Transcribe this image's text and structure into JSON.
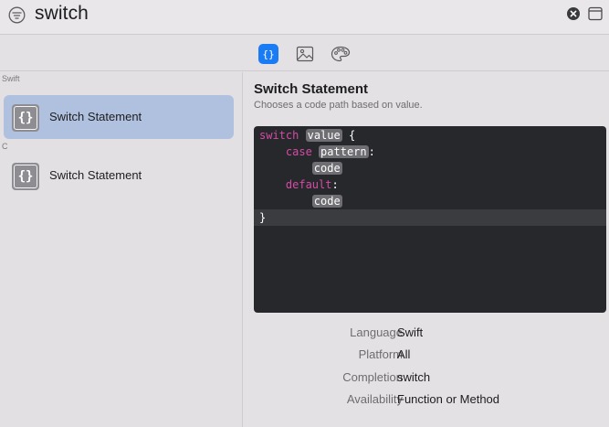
{
  "search": {
    "query": "switch"
  },
  "toolbar": {
    "tabs": [
      {
        "name": "code-snippets",
        "selected": true
      },
      {
        "name": "media",
        "selected": false
      },
      {
        "name": "colors",
        "selected": false
      }
    ]
  },
  "sidebar": {
    "sections": [
      {
        "header": "Swift",
        "items": [
          {
            "label": "Switch Statement",
            "icon": "{}",
            "selected": true
          }
        ]
      },
      {
        "header": "C",
        "items": [
          {
            "label": "Switch Statement",
            "icon": "{}",
            "selected": false
          }
        ]
      }
    ]
  },
  "detail": {
    "title": "Switch Statement",
    "subtitle": "Chooses a code path based on value.",
    "code": {
      "keyword_switch": "switch",
      "placeholder_value": "value",
      "open_brace": "{",
      "keyword_case": "case",
      "placeholder_pattern": "pattern",
      "colon": ":",
      "placeholder_code1": "code",
      "keyword_default": "default",
      "placeholder_code2": "code",
      "close_brace": "}"
    },
    "properties": [
      {
        "label": "Language",
        "value": "Swift"
      },
      {
        "label": "Platform",
        "value": "All"
      },
      {
        "label": "Completion",
        "value": "switch"
      },
      {
        "label": "Availability",
        "value": "Function or Method"
      }
    ]
  },
  "colors": {
    "accent": "#1a7cf5",
    "selection": "#afc1df",
    "code_background": "#27282c",
    "keyword": "#d64ba6"
  }
}
